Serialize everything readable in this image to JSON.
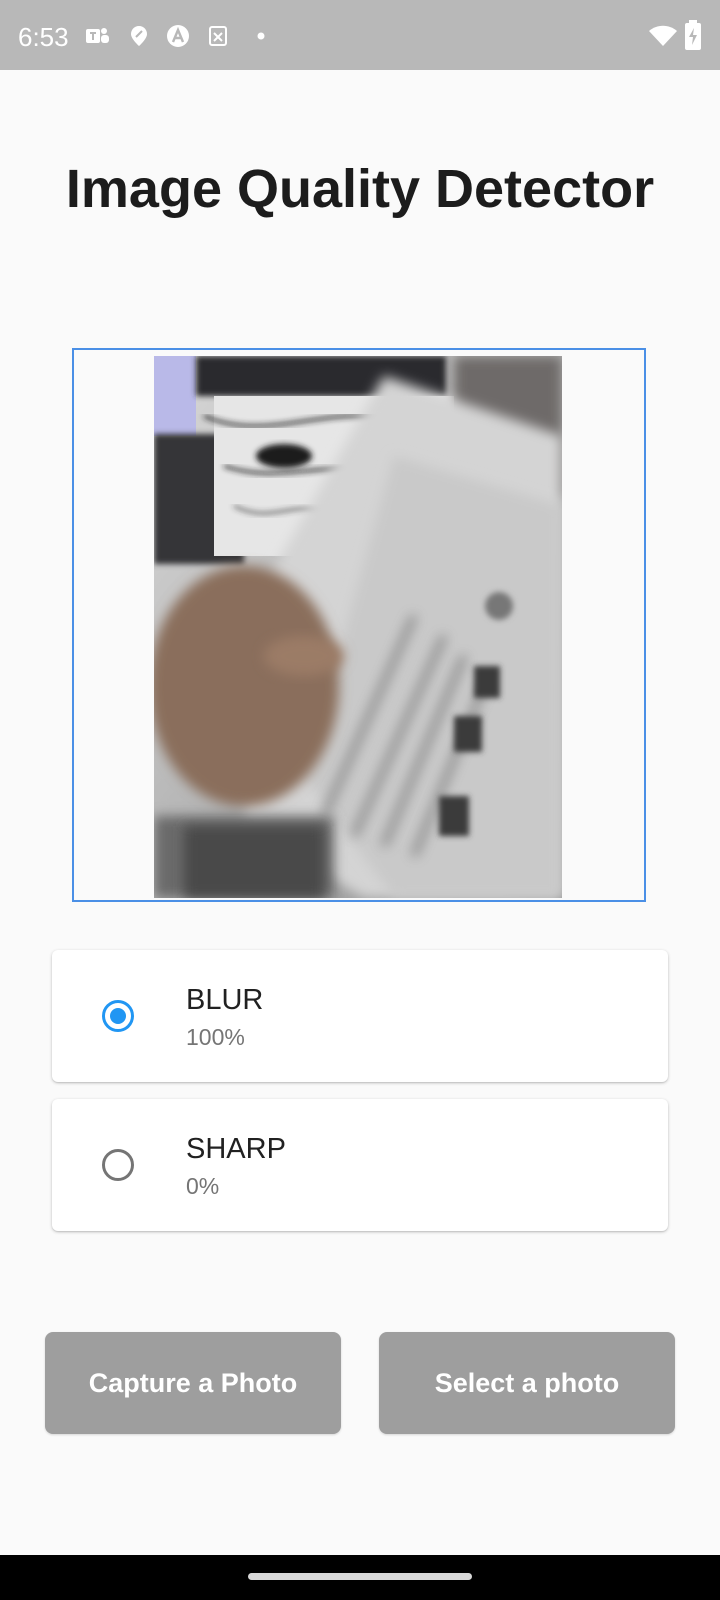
{
  "status_bar": {
    "time": "6:53",
    "notification_icons": [
      "teams-icon",
      "location-pin-icon",
      "a-letter-icon",
      "close-box-icon",
      "dot-icon"
    ],
    "system_icons": [
      "wifi-icon",
      "battery-charging-icon"
    ]
  },
  "header": {
    "title": "Image Quality Detector"
  },
  "preview": {
    "accent_color": "#4a8fe6"
  },
  "results": [
    {
      "label": "BLUR",
      "value": "100%",
      "selected": true
    },
    {
      "label": "SHARP",
      "value": "0%",
      "selected": false
    }
  ],
  "actions": {
    "capture_label": "Capture a Photo",
    "select_label": "Select a photo",
    "button_color": "#9e9e9e"
  },
  "colors": {
    "radio_selected": "#2196f3",
    "status_bar": "#b8b8b8",
    "background": "#fafafa"
  }
}
